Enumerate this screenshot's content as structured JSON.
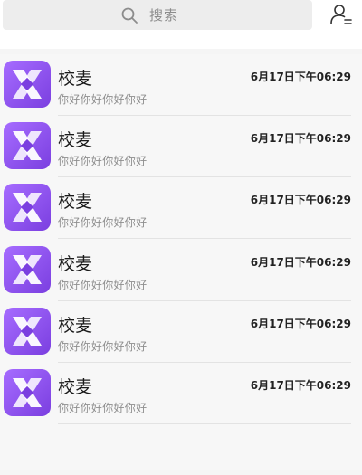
{
  "search": {
    "placeholder": "搜索"
  },
  "colors": {
    "brand": "#7b3fe0",
    "brand_light": "#a66cff",
    "background": "#f7f7f7"
  },
  "conversations": [
    {
      "name": "校麦",
      "time": "6月17日下午06:29",
      "message": "你好你好你好你好"
    },
    {
      "name": "校麦",
      "time": "6月17日下午06:29",
      "message": "你好你好你好你好"
    },
    {
      "name": "校麦",
      "time": "6月17日下午06:29",
      "message": "你好你好你好你好"
    },
    {
      "name": "校麦",
      "time": "6月17日下午06:29",
      "message": "你好你好你好你好"
    },
    {
      "name": "校麦",
      "time": "6月17日下午06:29",
      "message": "你好你好你好你好"
    },
    {
      "name": "校麦",
      "time": "6月17日下午06:29",
      "message": "你好你好你好你好"
    }
  ],
  "icons": {
    "search": "search-icon",
    "user": "user-menu-icon",
    "avatar": "x-logo-icon"
  }
}
